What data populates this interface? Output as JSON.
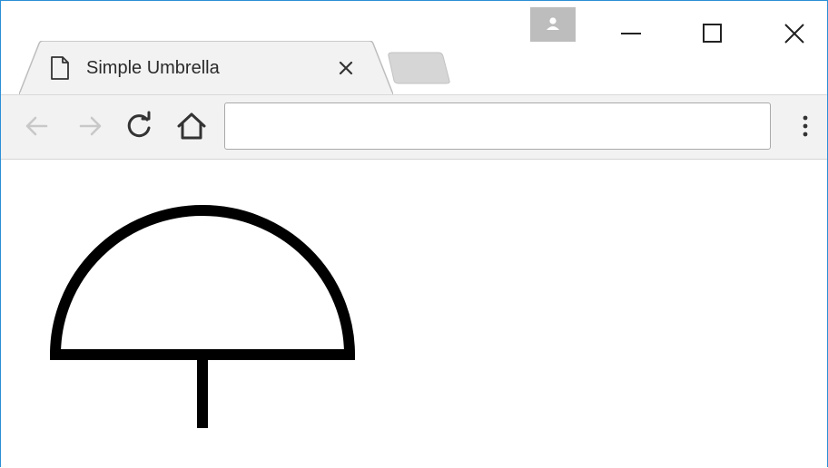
{
  "tab": {
    "title": "Simple Umbrella",
    "page_icon": "page-icon",
    "close_icon": "close-icon"
  },
  "titlebar": {
    "profile_icon": "person-icon",
    "minimize_icon": "minimize-icon",
    "maximize_icon": "maximize-icon",
    "close_icon": "close-icon"
  },
  "toolbar": {
    "back_icon": "arrow-left-icon",
    "forward_icon": "arrow-right-icon",
    "reload_icon": "reload-icon",
    "home_icon": "home-icon",
    "menu_icon": "more-vert-icon",
    "address_value": "",
    "address_placeholder": ""
  },
  "content": {
    "drawing": "umbrella",
    "stroke_color": "#000000",
    "background_color": "#ffffff"
  },
  "colors": {
    "window_border": "#2b8fd6",
    "toolbar_bg": "#f2f2f2",
    "tab_bg": "#f2f2f2",
    "profile_bg": "#bdbdbd",
    "disabled_icon": "#c8c8c8"
  }
}
